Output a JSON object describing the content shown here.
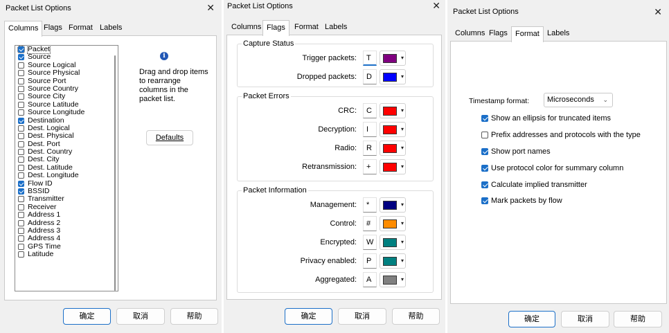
{
  "columns_dialog": {
    "title": "Packet List Options",
    "close_glyph": "✕",
    "tabs": [
      "Columns",
      "Flags",
      "Format",
      "Labels"
    ],
    "active_tab": "Columns",
    "columns": [
      {
        "label": "Packet",
        "checked": true
      },
      {
        "label": "Source",
        "checked": true
      },
      {
        "label": "Source Logical",
        "checked": false
      },
      {
        "label": "Source Physical",
        "checked": false
      },
      {
        "label": "Source Port",
        "checked": false
      },
      {
        "label": "Source Country",
        "checked": false
      },
      {
        "label": "Source City",
        "checked": false
      },
      {
        "label": "Source Latitude",
        "checked": false
      },
      {
        "label": "Source Longitude",
        "checked": false
      },
      {
        "label": "Destination",
        "checked": true
      },
      {
        "label": "Dest. Logical",
        "checked": false
      },
      {
        "label": "Dest. Physical",
        "checked": false
      },
      {
        "label": "Dest. Port",
        "checked": false
      },
      {
        "label": "Dest. Country",
        "checked": false
      },
      {
        "label": "Dest. City",
        "checked": false
      },
      {
        "label": "Dest. Latitude",
        "checked": false
      },
      {
        "label": "Dest. Longitude",
        "checked": false
      },
      {
        "label": "Flow ID",
        "checked": true
      },
      {
        "label": "BSSID",
        "checked": true
      },
      {
        "label": "Transmitter",
        "checked": false
      },
      {
        "label": "Receiver",
        "checked": false
      },
      {
        "label": "Address 1",
        "checked": false
      },
      {
        "label": "Address 2",
        "checked": false
      },
      {
        "label": "Address 3",
        "checked": false
      },
      {
        "label": "Address 4",
        "checked": false
      },
      {
        "label": "GPS Time",
        "checked": false
      },
      {
        "label": "Latitude",
        "checked": false
      }
    ],
    "info_glyph": "i",
    "help_text": "Drag and drop items to rearrange columns in the packet list.",
    "defaults_button": "Defaults",
    "buttons": {
      "ok": "确定",
      "cancel": "取消",
      "help": "帮助"
    }
  },
  "flags_dialog": {
    "title": "Packet List Options",
    "close_glyph": "✕",
    "tabs": [
      "Columns",
      "Flags",
      "Format",
      "Labels"
    ],
    "active_tab": "Flags",
    "groups": [
      {
        "title": "Capture Status",
        "rows": [
          {
            "label": "Trigger packets:",
            "char": "T",
            "color": "#800080"
          },
          {
            "label": "Dropped packets:",
            "char": "D",
            "color": "#0000ff"
          }
        ]
      },
      {
        "title": "Packet Errors",
        "rows": [
          {
            "label": "CRC:",
            "char": "C",
            "color": "#ff0000"
          },
          {
            "label": "Decryption:",
            "char": "I",
            "color": "#ff0000"
          },
          {
            "label": "Radio:",
            "char": "R",
            "color": "#ff0000"
          },
          {
            "label": "Retransmission:",
            "char": "+",
            "color": "#ff0000"
          }
        ]
      },
      {
        "title": "Packet Information",
        "rows": [
          {
            "label": "Management:",
            "char": "*",
            "color": "#000080"
          },
          {
            "label": "Control:",
            "char": "#",
            "color": "#ff8c00"
          },
          {
            "label": "Encrypted:",
            "char": "W",
            "color": "#008080"
          },
          {
            "label": "Privacy enabled:",
            "char": "P",
            "color": "#008080"
          },
          {
            "label": "Aggregated:",
            "char": "A",
            "color": "#808080"
          }
        ]
      }
    ],
    "dropdown_glyph": "▾",
    "buttons": {
      "ok": "确定",
      "cancel": "取消",
      "help": "帮助"
    }
  },
  "format_dialog": {
    "title": "Packet List Options",
    "close_glyph": "✕",
    "tabs": [
      "Columns",
      "Flags",
      "Format",
      "Labels"
    ],
    "active_tab": "Format",
    "timestamp_label": "Timestamp format:",
    "timestamp_value": "Microseconds",
    "chevron_glyph": "⌄",
    "options": [
      {
        "label": "Show an ellipsis for truncated items",
        "checked": true
      },
      {
        "label": "Prefix addresses and protocols with the type",
        "checked": false
      },
      {
        "label": "Show port names",
        "checked": true
      },
      {
        "label": "Use protocol color for summary column",
        "checked": true
      },
      {
        "label": "Calculate implied transmitter",
        "checked": true
      },
      {
        "label": "Mark packets by flow",
        "checked": true
      }
    ],
    "buttons": {
      "ok": "确定",
      "cancel": "取消",
      "help": "帮助"
    }
  }
}
